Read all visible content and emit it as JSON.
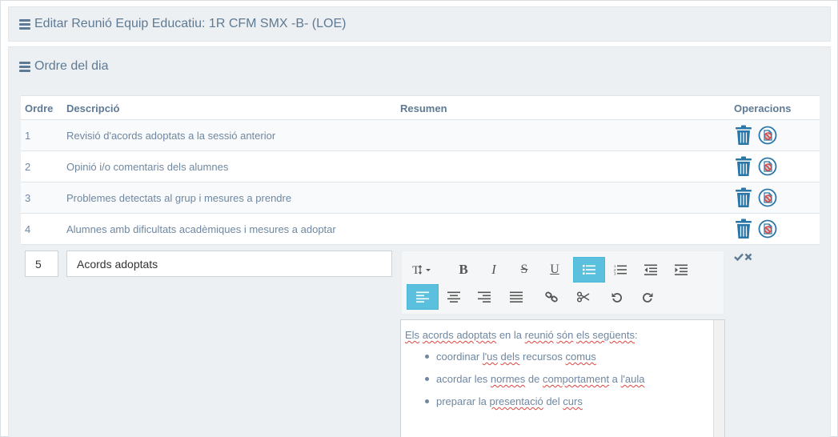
{
  "header": {
    "title": "Editar Reunió Equip Educatiu: 1R CFM SMX -B- (LOE)"
  },
  "section": {
    "title": "Ordre del dia"
  },
  "table": {
    "columns": {
      "order": "Ordre",
      "description": "Descripció",
      "summary": "Resumen",
      "operations": "Operacions"
    },
    "rows": [
      {
        "order": "1",
        "description": "Revisió d'acords adoptats a la sessió anterior"
      },
      {
        "order": "2",
        "description": "Opinió i/o comentaris dels alumnes"
      },
      {
        "order": "3",
        "description": "Problemes detectats al grup i mesures a prendre"
      },
      {
        "order": "4",
        "description": "Alumnes amb dificultats acadèmiques i mesures a adoptar"
      }
    ]
  },
  "edit": {
    "order_value": "5",
    "description_value": "Acords adoptats",
    "editor": {
      "intro": [
        "Els",
        " ",
        "acords adoptats",
        " en la ",
        "reunió",
        " ",
        "són",
        " ",
        "els següents",
        ":"
      ],
      "items": [
        [
          "coordinar ",
          "l'us",
          " ",
          "dels",
          " recursos ",
          "comus",
          ""
        ],
        [
          "acordar les ",
          "normes",
          " de ",
          "comportament",
          " a ",
          "l'aula",
          ""
        ],
        [
          "preparar la ",
          "presentació",
          " del ",
          "curs",
          ""
        ]
      ]
    }
  },
  "icons": {
    "delete": "trash-icon",
    "summary": "no-document-icon",
    "confirm": "check-icon",
    "cancel": "x-icon"
  },
  "colors": {
    "accent": "#5bc0de",
    "text": "#5f7a94",
    "trash": "#2a76a8",
    "forbidden": "#e0443e"
  }
}
